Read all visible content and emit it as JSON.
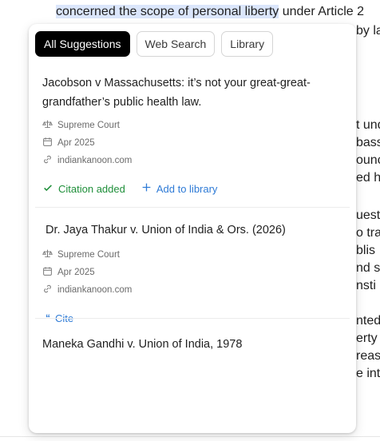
{
  "background": {
    "line1_highlight": "concerned the scope of personal liberty",
    "line1_rest": " under Article 2",
    "line2": "by la",
    "right_fragments": [
      "t und",
      "bass",
      "ounc",
      "ed h",
      "uest",
      "o tra",
      "blis",
      "nd s",
      "nsti",
      "nted",
      "erty",
      "reas",
      "e int"
    ]
  },
  "tabs": [
    {
      "label": "All Suggestions",
      "active": true
    },
    {
      "label": "Web Search",
      "active": false
    },
    {
      "label": "Library",
      "active": false
    }
  ],
  "results": [
    {
      "title": "Jacobson v Massachusetts: it’s not your great-great-grandfather’s public health law.",
      "court": "Supreme Court",
      "date": "Apr 2025",
      "source": "indiankanoon.com",
      "citation_status": "Citation added",
      "add_label": "Add to library"
    },
    {
      "title": "Dr. Jaya Thakur v. Union of India & Ors. (2026)",
      "court": "Supreme Court",
      "date": "Apr 2025",
      "source": "indiankanoon.com",
      "cite_label": "Cite"
    },
    {
      "title": "Maneka Gandhi v. Union of India, 1978"
    }
  ],
  "icons": {
    "court": "scales-icon",
    "date": "calendar-icon",
    "source": "link-icon",
    "added": "check-icon",
    "add": "plus-icon",
    "cite": "quote-icon"
  },
  "colors": {
    "accent_blue": "#2f7bd6",
    "success_green": "#1f8f3a",
    "active_tab": "#000000"
  }
}
